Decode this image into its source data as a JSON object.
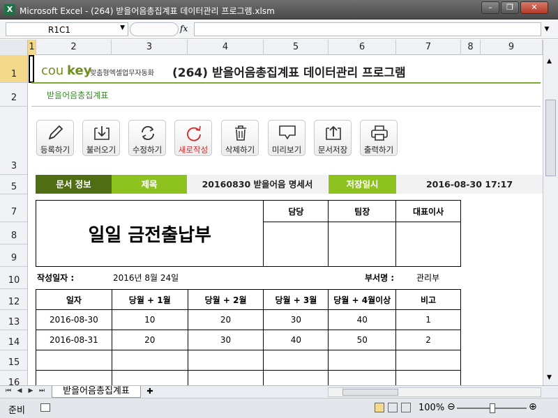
{
  "window": {
    "title": "Microsoft Excel - (264) 받을어음총집계표 데이터관리 프로그램.xlsm",
    "app_icon": "X"
  },
  "formula_bar": {
    "name_box": "R1C1",
    "fx": "fx",
    "formula": ""
  },
  "columns": [
    "1",
    "2",
    "3",
    "4",
    "5",
    "6",
    "7",
    "8",
    "9"
  ],
  "rows": [
    "1",
    "2",
    "3",
    "5",
    "7",
    "8",
    "9",
    "10",
    "12",
    "13",
    "14",
    "15",
    "16"
  ],
  "header": {
    "logo_a": "cou",
    "logo_b": "key",
    "logo_sub": "맞춤형엑셀업무자동화",
    "title": "(264) 받을어음총집계표 데이터관리 프로그램",
    "subtitle": "받을어음총집계표"
  },
  "toolbar": [
    {
      "label": "등록하기",
      "icon": "pencil-icon"
    },
    {
      "label": "불러오기",
      "icon": "download-icon"
    },
    {
      "label": "수정하기",
      "icon": "refresh-icon"
    },
    {
      "label": "새로작성",
      "icon": "redo-icon"
    },
    {
      "label": "삭제하기",
      "icon": "trash-icon"
    },
    {
      "label": "미리보기",
      "icon": "monitor-icon"
    },
    {
      "label": "문서저장",
      "icon": "upload-icon"
    },
    {
      "label": "출력하기",
      "icon": "printer-icon"
    }
  ],
  "info_bar": {
    "doc_info": "문서 정보",
    "title_label": "제목",
    "title_value": "20160830 받을어음 명세서",
    "saved_label": "저장일시",
    "saved_value": "2016-08-30 17:17"
  },
  "document": {
    "heading": "일일 금전출납부",
    "approvals": [
      "담당",
      "팀장",
      "대표이사"
    ],
    "date_label": "작성일자 :",
    "date_value": "2016년 8월 24일",
    "dept_label": "부서명 :",
    "dept_value": "관리부",
    "table_headers": [
      "일자",
      "당월 + 1월",
      "당월 + 2월",
      "당월 + 3월",
      "당월 + 4월이상",
      "비고"
    ],
    "table_rows": [
      [
        "2016-08-30",
        "10",
        "20",
        "30",
        "40",
        "1"
      ],
      [
        "2016-08-31",
        "20",
        "30",
        "40",
        "50",
        "2"
      ],
      [
        "",
        "",
        "",
        "",
        "",
        ""
      ],
      [
        "",
        "",
        "",
        "",
        "",
        ""
      ]
    ]
  },
  "sheet_tab": "받을어음총집계표",
  "status": {
    "ready": "준비",
    "zoom": "100%"
  },
  "colors": {
    "accent_dark": "#4f6e14",
    "accent_light": "#8dc21f"
  }
}
